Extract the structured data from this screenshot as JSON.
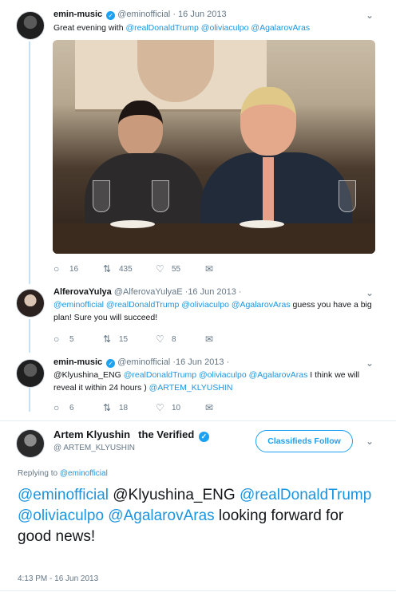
{
  "tweets": [
    {
      "name": "emin-music",
      "handle": "@eminofficial",
      "date": "· 16 Jun 2013",
      "text_parts": [
        "Great evening with ",
        "@realDonaldTrump",
        " ",
        "@oliviaculpo",
        " ",
        "@AgalarovAras"
      ],
      "replies": "16",
      "retweets": "435",
      "likes": "55"
    },
    {
      "name": "AlferovaYulya",
      "handle": "@AlferovaYulyaE",
      "date": "·16 Jun 2013 ·",
      "text_parts": [
        "@eminofficial",
        " ",
        "@realDonaldTrump",
        " ",
        "@oliviaculpo",
        " ",
        "@AgalarovAras",
        " guess you have a big plan! Sure you will succeed!"
      ],
      "replies": "5",
      "retweets": "15",
      "likes": "8"
    },
    {
      "name": "emin-music",
      "handle": "@eminofficial",
      "date": "·16 Jun 2013 ·",
      "text_parts": [
        "@Klyushina_ENG ",
        "@realDonaldTrump",
        " ",
        "@oliviaculpo",
        " ",
        "@AgalarovAras",
        " I think we will reveal it within 24 hours ) ",
        "@ARTEM_KLYUSHIN"
      ],
      "replies": "6",
      "retweets": "18",
      "likes": "10"
    }
  ],
  "main": {
    "name": "Artem Klyushin  the Verified",
    "handle": "@ ARTEM_KLYUSHIN",
    "follow_label": "Classifieds Follow",
    "replying_prefix": "Replying to ",
    "replying_to": "@eminofficial",
    "text_parts": [
      "@eminofficial",
      " @Klyushina_ENG ",
      "@realDonaldTrump",
      " ",
      "@oliviaculpo",
      " ",
      "@AgalarovAras",
      " looking forward for good news!"
    ],
    "timestamp": "4:13 PM - 16 Jun 2013"
  },
  "icons": {
    "reply": "reply-icon",
    "retweet": "retweet-icon",
    "like": "heart-icon",
    "dm": "envelope-icon",
    "more": "chevron-down-icon",
    "verified": "verified-badge-icon"
  },
  "colors": {
    "link": "#1b95e0",
    "verified": "#1da1f2",
    "secondary": "#657786",
    "thread": "#c4dff6"
  }
}
